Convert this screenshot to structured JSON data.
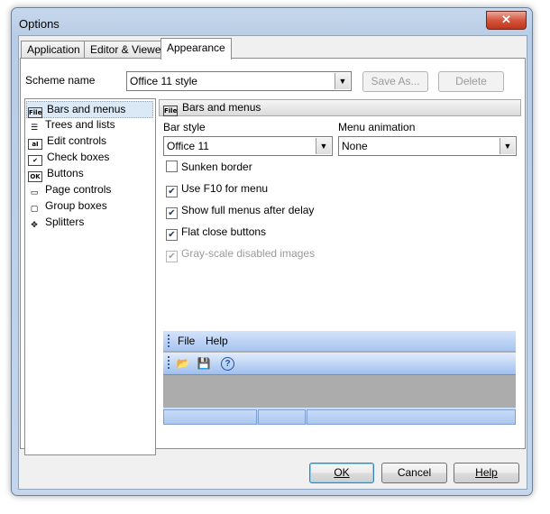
{
  "window": {
    "title": "Options",
    "close_glyph": "✕"
  },
  "tabs": [
    {
      "label": "Application",
      "active": false
    },
    {
      "label": "Editor & Viewers",
      "active": false
    },
    {
      "label": "Appearance",
      "active": true
    }
  ],
  "scheme": {
    "label": "Scheme name",
    "value": "Office 11 style",
    "save_as_label": "Save As...",
    "delete_label": "Delete"
  },
  "tree": {
    "items": [
      {
        "label": "Bars and menus",
        "icon": "menu-icon",
        "glyph": "File",
        "selected": true
      },
      {
        "label": "Trees and lists",
        "icon": "tree-list-icon",
        "glyph": "☰",
        "selected": false
      },
      {
        "label": "Edit controls",
        "icon": "edit-control-icon",
        "glyph": "aI",
        "selected": false
      },
      {
        "label": "Check boxes",
        "icon": "checkbox-icon",
        "glyph": "✔",
        "selected": false
      },
      {
        "label": "Buttons",
        "icon": "button-icon",
        "glyph": "OK",
        "selected": false
      },
      {
        "label": "Page controls",
        "icon": "page-control-icon",
        "glyph": "▭",
        "selected": false
      },
      {
        "label": "Group boxes",
        "icon": "group-box-icon",
        "glyph": "▢",
        "selected": false
      },
      {
        "label": "Splitters",
        "icon": "splitter-icon",
        "glyph": "✥",
        "selected": false
      }
    ]
  },
  "panel": {
    "header": "Bars and menus",
    "header_icon_glyph": "File",
    "bar_style_label": "Bar style",
    "bar_style_value": "Office 11",
    "menu_animation_label": "Menu animation",
    "menu_animation_value": "None",
    "checks": [
      {
        "label": "Sunken border",
        "checked": false,
        "enabled": true
      },
      {
        "label": "Use F10 for menu",
        "checked": true,
        "enabled": true
      },
      {
        "label": "Show full menus after delay",
        "checked": true,
        "enabled": true
      },
      {
        "label": "Flat close buttons",
        "checked": true,
        "enabled": true
      },
      {
        "label": "Gray-scale disabled images",
        "checked": true,
        "enabled": false
      }
    ]
  },
  "preview": {
    "menu_file": "File",
    "menu_help": "Help",
    "icons": [
      "open-folder-icon",
      "save-icon",
      "help-icon"
    ]
  },
  "buttons": {
    "ok": "OK",
    "cancel": "Cancel",
    "help": "Help"
  },
  "check_glyph": "✔"
}
